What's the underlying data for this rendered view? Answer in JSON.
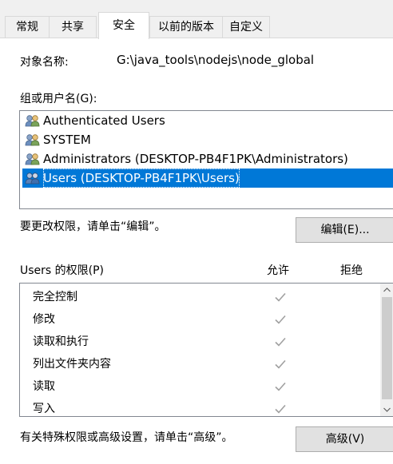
{
  "tabs": [
    {
      "label": "常规"
    },
    {
      "label": "共享"
    },
    {
      "label": "安全"
    },
    {
      "label": "以前的版本"
    },
    {
      "label": "自定义"
    }
  ],
  "object_name": {
    "label": "对象名称:",
    "value": "G:\\java_tools\\nodejs\\node_global"
  },
  "groups": {
    "label": "组或用户名(G):",
    "items": [
      {
        "label": "Authenticated Users",
        "icon": "users-group-icon",
        "selected": false
      },
      {
        "label": "SYSTEM",
        "icon": "users-group-icon",
        "selected": false
      },
      {
        "label": "Administrators (DESKTOP-PB4F1PK\\Administrators)",
        "icon": "users-group-icon",
        "selected": false
      },
      {
        "label": "Users (DESKTOP-PB4F1PK\\Users)",
        "icon": "users-group-icon",
        "selected": true
      }
    ]
  },
  "edit_hint": "要更改权限，请单击“编辑”。",
  "edit_button": "编辑(E)...",
  "permissions": {
    "label": "Users 的权限(P)",
    "allow_header": "允许",
    "deny_header": "拒绝",
    "rows": [
      {
        "name": "完全控制",
        "allow": true,
        "deny": false
      },
      {
        "name": "修改",
        "allow": true,
        "deny": false
      },
      {
        "name": "读取和执行",
        "allow": true,
        "deny": false
      },
      {
        "name": "列出文件夹内容",
        "allow": true,
        "deny": false
      },
      {
        "name": "读取",
        "allow": true,
        "deny": false
      },
      {
        "name": "写入",
        "allow": true,
        "deny": false
      }
    ]
  },
  "advanced_hint": "有关特殊权限或高级设置，请单击“高级”。",
  "advanced_button": "高级(V)",
  "colors": {
    "selection": "#0078d7",
    "check_disabled": "#a0a0a0"
  }
}
